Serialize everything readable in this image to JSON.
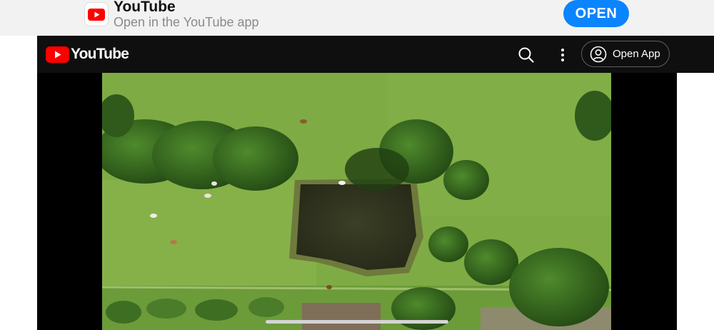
{
  "banner": {
    "app_name": "YouTube",
    "subtitle": "Open in the YouTube app",
    "open_label": "OPEN",
    "icon": "youtube-app-icon",
    "accent_color": "#0a84ff"
  },
  "header": {
    "logo_text": "YouTube",
    "logo_color": "#ff0000",
    "search_icon": "search-icon",
    "more_icon": "more-vert-icon",
    "open_app_label": "Open App",
    "account_icon": "account-circle-icon",
    "background": "#0f0f0f"
  },
  "player": {
    "content": "aerial view of pasture with pond, trees and grazing cows",
    "background": "#000000"
  }
}
